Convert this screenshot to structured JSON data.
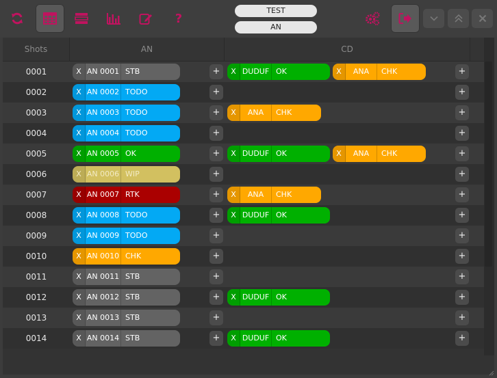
{
  "toolbar": {
    "icons": [
      "refresh-icon",
      "table-icon",
      "list-icon",
      "bar-chart-icon",
      "edit-icon",
      "help-icon"
    ],
    "help_glyph": "?",
    "accent_color": "#c0135f",
    "field_project": "TEST",
    "field_task": "AN"
  },
  "columns": {
    "shots": "Shots",
    "an": "AN",
    "cd": "CD"
  },
  "chip_x": "X",
  "plus": "+",
  "status_colors": {
    "STB": "#636363",
    "TODO": "#03a9f4",
    "OK": "#00b000",
    "WIP": "#d2c060",
    "RTK": "#aa0000",
    "CHK": "#ffa800"
  },
  "rows": [
    {
      "shot": "0001",
      "an": {
        "name": "AN 0001",
        "status": "STB"
      },
      "cd": [
        {
          "name": "DUDUF",
          "status": "OK"
        },
        {
          "name": "ANA",
          "status": "CHK"
        }
      ]
    },
    {
      "shot": "0002",
      "an": {
        "name": "AN 0002",
        "status": "TODO"
      },
      "cd": []
    },
    {
      "shot": "0003",
      "an": {
        "name": "AN 0003",
        "status": "TODO"
      },
      "cd": [
        {
          "name": "ANA",
          "status": "CHK"
        }
      ]
    },
    {
      "shot": "0004",
      "an": {
        "name": "AN 0004",
        "status": "TODO"
      },
      "cd": []
    },
    {
      "shot": "0005",
      "an": {
        "name": "AN 0005",
        "status": "OK"
      },
      "cd": [
        {
          "name": "DUDUF",
          "status": "OK"
        },
        {
          "name": "ANA",
          "status": "CHK"
        }
      ]
    },
    {
      "shot": "0006",
      "an": {
        "name": "AN 0006",
        "status": "WIP"
      },
      "cd": []
    },
    {
      "shot": "0007",
      "an": {
        "name": "AN 0007",
        "status": "RTK"
      },
      "cd": [
        {
          "name": "ANA",
          "status": "CHK"
        }
      ]
    },
    {
      "shot": "0008",
      "an": {
        "name": "AN 0008",
        "status": "TODO"
      },
      "cd": [
        {
          "name": "DUDUF",
          "status": "OK"
        }
      ]
    },
    {
      "shot": "0009",
      "an": {
        "name": "AN 0009",
        "status": "TODO"
      },
      "cd": []
    },
    {
      "shot": "0010",
      "an": {
        "name": "AN 0010",
        "status": "CHK"
      },
      "cd": []
    },
    {
      "shot": "0011",
      "an": {
        "name": "AN 0011",
        "status": "STB"
      },
      "cd": []
    },
    {
      "shot": "0012",
      "an": {
        "name": "AN 0012",
        "status": "STB"
      },
      "cd": [
        {
          "name": "DUDUF",
          "status": "OK"
        }
      ]
    },
    {
      "shot": "0013",
      "an": {
        "name": "AN 0013",
        "status": "STB"
      },
      "cd": []
    },
    {
      "shot": "0014",
      "an": {
        "name": "AN 0014",
        "status": "STB"
      },
      "cd": [
        {
          "name": "DUDUF",
          "status": "OK"
        }
      ]
    }
  ]
}
